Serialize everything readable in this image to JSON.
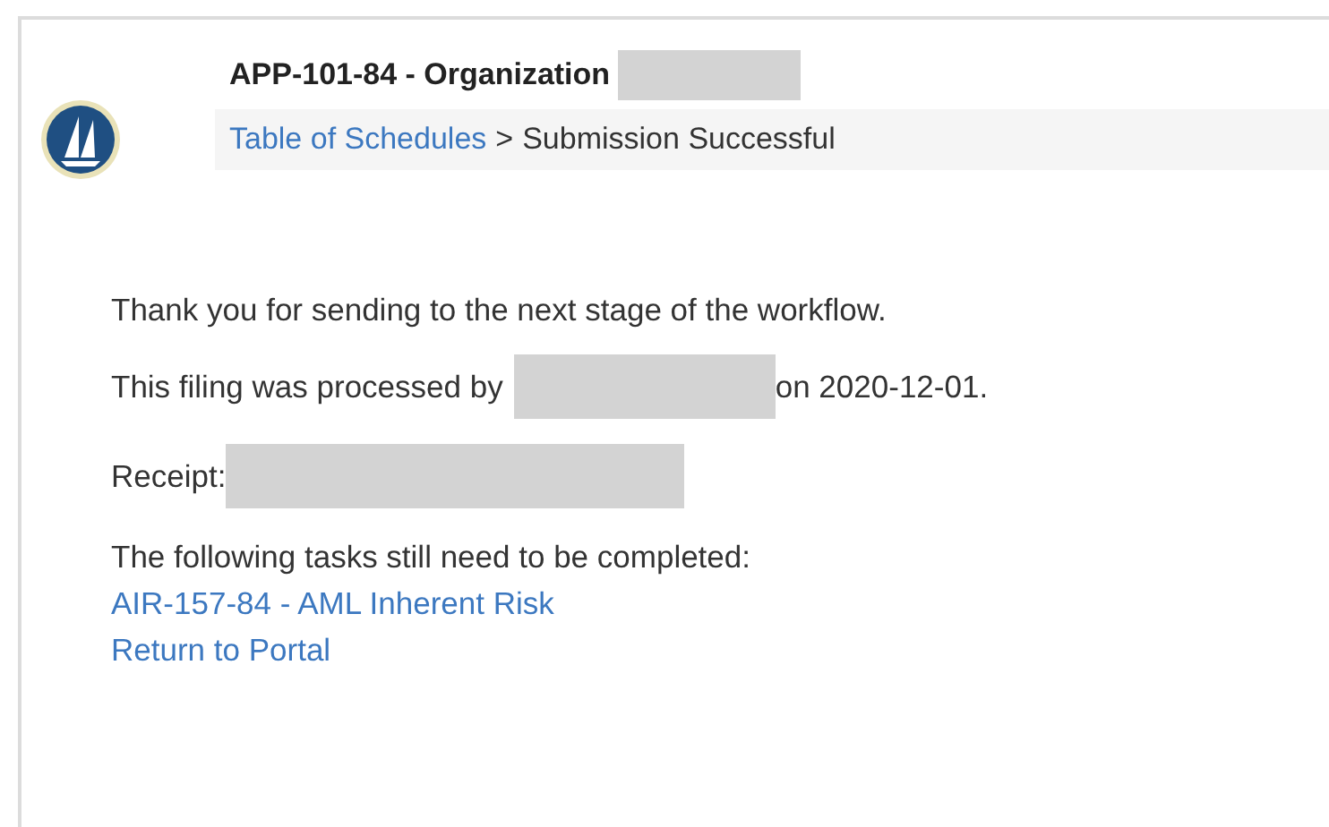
{
  "header": {
    "title": "APP-101-84 - Organization",
    "title_redacted": true
  },
  "breadcrumb": [
    {
      "label": "Table of Schedules",
      "kind": "link"
    },
    {
      "label": ">",
      "kind": "separator"
    },
    {
      "label": "Submission Successful",
      "kind": "current"
    }
  ],
  "message": "Thank you for sending to the next stage of the workflow.",
  "processed": {
    "prefix": "This filing was processed by",
    "redacted": true,
    "suffix": "on 2020-12-01."
  },
  "receipt": {
    "label": "Receipt:",
    "redacted": true
  },
  "tasks": {
    "label": "The following tasks still need to be completed:",
    "links": [
      "AIR-157-84 - AML Inherent Risk",
      "Return to Portal"
    ]
  }
}
